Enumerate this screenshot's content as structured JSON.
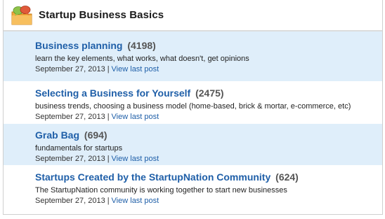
{
  "section": {
    "title": "Startup Business Basics",
    "icon": "chat-bubbles-icon"
  },
  "forums": [
    {
      "title": "Business planning",
      "count": "(4198)",
      "description": "learn the key elements, what works, what doesn't, get opinions",
      "date": "September 27, 2013",
      "separator": "|",
      "link": "View last post"
    },
    {
      "title": "Selecting a Business for Yourself",
      "count": "(2475)",
      "description": "business trends, choosing a business model (home-based, brick & mortar, e-commerce, etc)",
      "date": "September 27, 2013",
      "separator": "|",
      "link": "View last post"
    },
    {
      "title": "Grab Bag",
      "count": "(694)",
      "description": "fundamentals for startups",
      "date": "September 27, 2013",
      "separator": "|",
      "link": "View last post"
    },
    {
      "title": "Startups Created by the StartupNation Community",
      "count": "(624)",
      "description": "The StartupNation community is working together to start new businesses",
      "date": "September 27, 2013",
      "separator": "|",
      "link": "View last post"
    }
  ],
  "colors": {
    "link": "#1f5fa8",
    "row_highlight": "#dfeefa",
    "icon_folder": "#f2a93b",
    "icon_bubble_green": "#8fc34a",
    "icon_bubble_red": "#e05a3a"
  }
}
